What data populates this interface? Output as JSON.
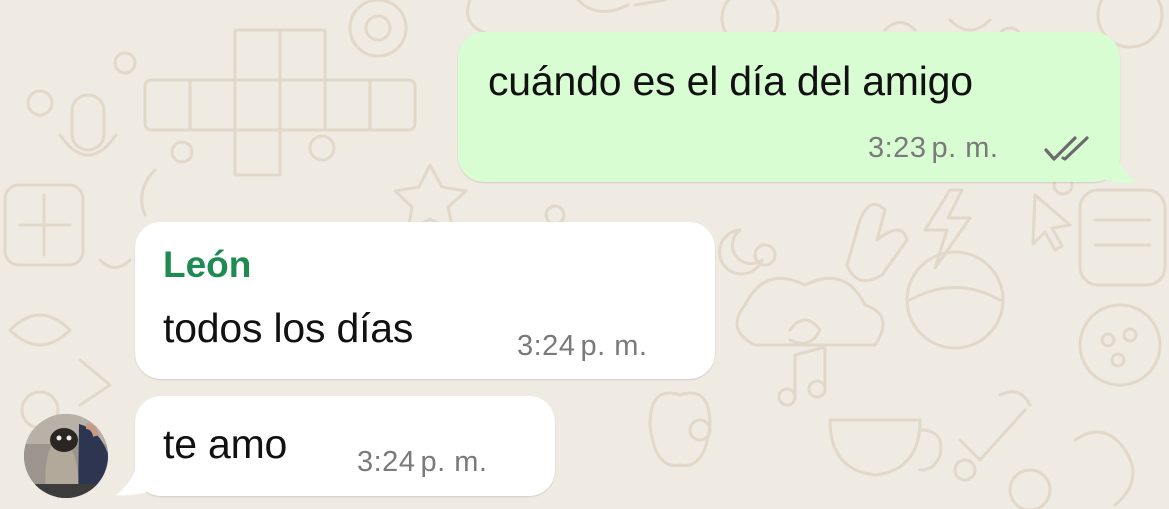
{
  "chat": {
    "messages": [
      {
        "direction": "outgoing",
        "text": "cuándo es el día del amigo",
        "time": "3:23",
        "period": "p. m.",
        "status_icon": "double-check-read-icon"
      },
      {
        "direction": "incoming",
        "sender": "León",
        "text": "todos los días",
        "time": "3:24",
        "period": "p. m."
      },
      {
        "direction": "incoming",
        "text": "te amo",
        "time": "3:24",
        "period": "p. m."
      }
    ],
    "avatar_icon": "contact-photo-avatar",
    "colors": {
      "background": "#efeae2",
      "outgoing_bubble": "#d9fdd3",
      "incoming_bubble": "#ffffff",
      "sender_name": "#1f8a52",
      "meta_text": "#7a7a7a"
    }
  }
}
